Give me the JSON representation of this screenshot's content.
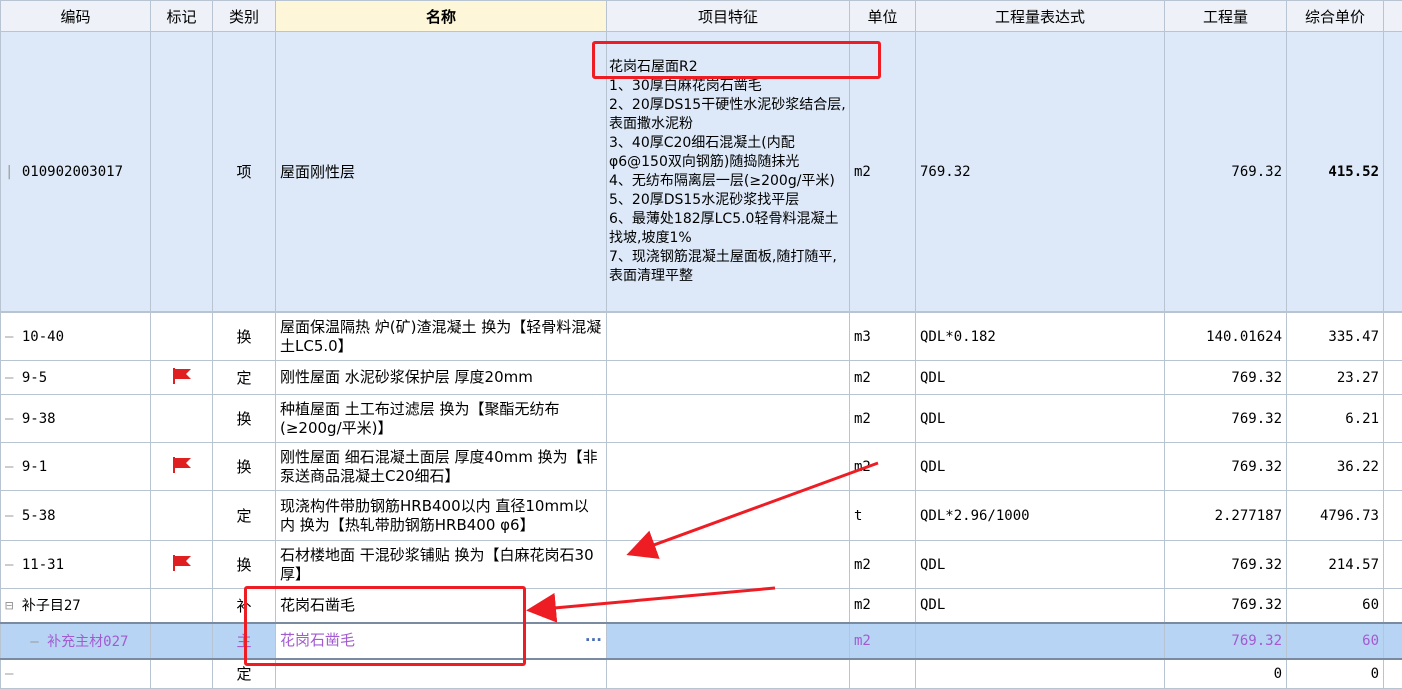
{
  "headers": [
    "编码",
    "标记",
    "类别",
    "名称",
    "项目特征",
    "单位",
    "工程量表达式",
    "工程量",
    "综合单价"
  ],
  "main_row": {
    "code": "010902003017",
    "kind": "项",
    "name": "屋面刚性层",
    "features": [
      "花岗石屋面R2",
      "1、30厚白麻花岗石凿毛",
      "2、20厚DS15干硬性水泥砂浆结合层,表面撒水泥粉",
      "3、40厚C20细石混凝土(内配φ6@150双向钢筋)随捣随抹光",
      "4、无纺布隔离层一层(≥200g/平米)",
      "5、20厚DS15水泥砂浆找平层",
      "6、最薄处182厚LC5.0轻骨料混凝土找坡,坡度1%",
      "7、现浇钢筋混凝土屋面板,随打随平,表面清理平整"
    ],
    "unit": "m2",
    "expr": "769.32",
    "qty": "769.32",
    "price": "415.52"
  },
  "rows": [
    {
      "code": "10-40",
      "flag": false,
      "kind": "换",
      "name": "屋面保温隔热 炉(矿)渣混凝土   换为【轻骨料混凝土LC5.0】",
      "unit": "m3",
      "expr": "QDL*0.182",
      "qty": "140.01624",
      "price": "335.47"
    },
    {
      "code": "9-5",
      "flag": true,
      "kind": "定",
      "name": "刚性屋面 水泥砂浆保护层 厚度20mm",
      "unit": "m2",
      "expr": "QDL",
      "qty": "769.32",
      "price": "23.27"
    },
    {
      "code": "9-38",
      "flag": false,
      "kind": "换",
      "name": "种植屋面 土工布过滤层   换为【聚酯无纺布(≥200g/平米)】",
      "unit": "m2",
      "expr": "QDL",
      "qty": "769.32",
      "price": "6.21"
    },
    {
      "code": "9-1",
      "flag": true,
      "kind": "换",
      "name": "刚性屋面 细石混凝土面层 厚度40mm   换为【非泵送商品混凝土C20细石】",
      "unit": "m2",
      "expr": "QDL",
      "qty": "769.32",
      "price": "36.22"
    },
    {
      "code": "5-38",
      "flag": false,
      "kind": "定",
      "name": "现浇构件带肋钢筋HRB400以内 直径10mm以内   换为【热轧带肋钢筋HRB400 φ6】",
      "unit": "t",
      "expr": "QDL*2.96/1000",
      "qty": "2.277187",
      "price": "4796.73"
    },
    {
      "code": "11-31",
      "flag": true,
      "kind": "换",
      "name": "石材楼地面 干混砂浆铺贴   换为【白麻花岗石30厚】",
      "unit": "m2",
      "expr": "QDL",
      "qty": "769.32",
      "price": "214.57"
    },
    {
      "code": "补子目27",
      "flag": false,
      "kind": "补",
      "name": "花岗石凿毛",
      "unit": "m2",
      "expr": "QDL",
      "qty": "769.32",
      "price": "60"
    },
    {
      "code": "补充主材027",
      "flag": false,
      "kind": "主",
      "name": "花岗石凿毛",
      "unit": "m2",
      "expr": "",
      "qty": "769.32",
      "price": "60"
    },
    {
      "code": "",
      "flag": false,
      "kind": "定",
      "name": "",
      "unit": "",
      "expr": "",
      "qty": "0",
      "price": "0"
    }
  ],
  "colors": {
    "annotation": "#ee1d24",
    "flag": "#e02020",
    "highlight_text": "#a35bd0"
  }
}
